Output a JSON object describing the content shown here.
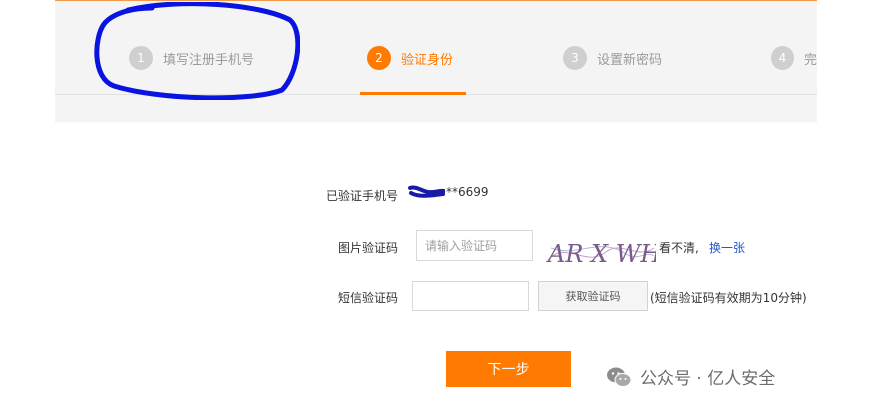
{
  "steps": [
    {
      "num": "1",
      "label": "填写注册手机号",
      "active": false
    },
    {
      "num": "2",
      "label": "验证身份",
      "active": true
    },
    {
      "num": "3",
      "label": "设置新密码",
      "active": false
    },
    {
      "num": "4",
      "label": "完",
      "active": false
    }
  ],
  "form": {
    "phone_label": "已验证手机号",
    "phone_value": "**6699",
    "captcha_label": "图片验证码",
    "captcha_placeholder": "请输入验证码",
    "captcha_text": "AR X WH",
    "captcha_unclear": "看不清,",
    "captcha_change": "换一张",
    "sms_label": "短信验证码",
    "sms_value": "",
    "sms_button": "获取验证码",
    "sms_hint": "(短信验证码有效期为10分钟)",
    "next_button": "下一步"
  },
  "watermark": {
    "text": "公众号 · 亿人安全",
    "icon": "wechat-icon"
  },
  "colors": {
    "accent": "#ff7a00",
    "annotation": "#0a14e0",
    "link": "#2255cc"
  }
}
